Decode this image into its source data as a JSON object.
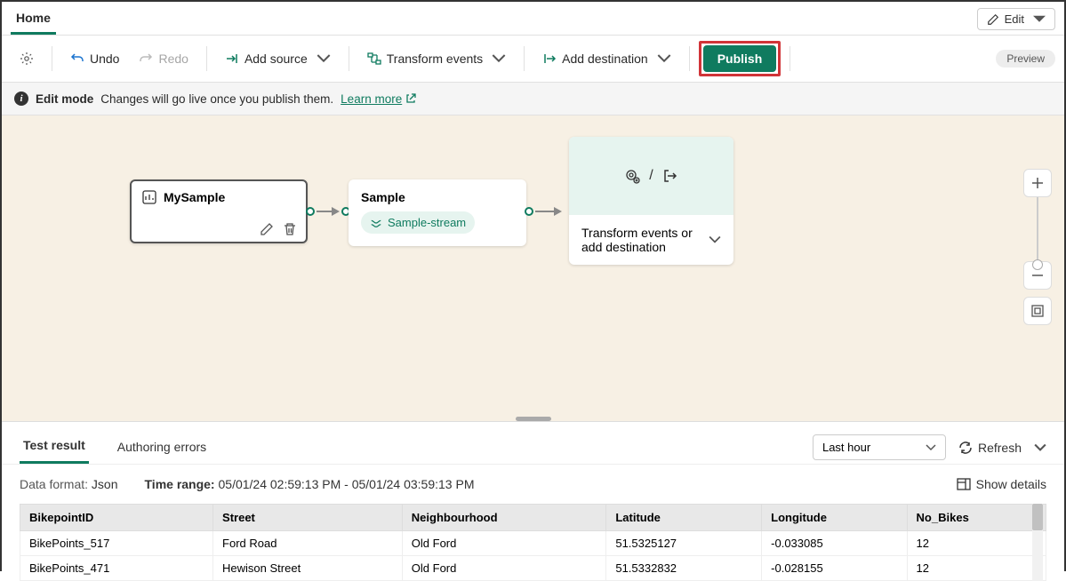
{
  "tabs": {
    "home": "Home"
  },
  "editButton": "Edit",
  "toolbar": {
    "undo": "Undo",
    "redo": "Redo",
    "addSource": "Add source",
    "transformEvents": "Transform events",
    "addDestination": "Add destination",
    "publish": "Publish"
  },
  "previewPill": "Preview",
  "infoBar": {
    "mode": "Edit mode",
    "message": "Changes will go live once you publish them.",
    "learnMore": "Learn more"
  },
  "canvas": {
    "sourceNode": {
      "title": "MySample"
    },
    "streamNode": {
      "title": "Sample",
      "chip": "Sample-stream"
    },
    "destNode": {
      "text": "Transform events or add destination"
    }
  },
  "bottomPanel": {
    "tabs": {
      "testResult": "Test result",
      "authoringErrors": "Authoring errors"
    },
    "timeSelect": "Last hour",
    "refresh": "Refresh",
    "dataFormatLabel": "Data format:",
    "dataFormatValue": "Json",
    "timeRangeLabel": "Time range:",
    "timeRangeValue": "05/01/24 02:59:13 PM - 05/01/24 03:59:13 PM",
    "showDetails": "Show details",
    "columns": [
      "BikepointID",
      "Street",
      "Neighbourhood",
      "Latitude",
      "Longitude",
      "No_Bikes"
    ],
    "rows": [
      [
        "BikePoints_517",
        "Ford Road",
        "Old Ford",
        "51.5325127",
        "-0.033085",
        "12"
      ],
      [
        "BikePoints_471",
        "Hewison Street",
        "Old Ford",
        "51.5332832",
        "-0.028155",
        "12"
      ]
    ]
  }
}
